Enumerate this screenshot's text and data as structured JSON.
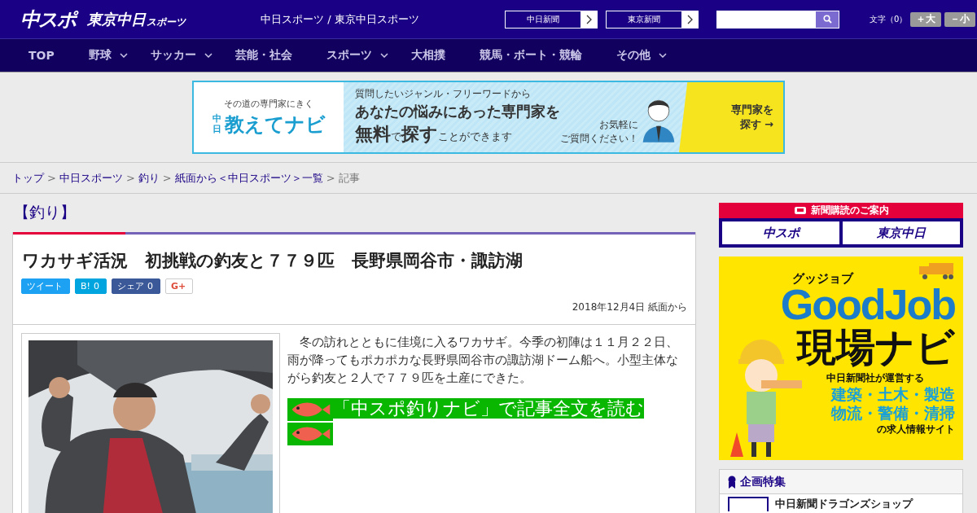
{
  "header": {
    "logo": "中スポ",
    "logo2": "東京中日",
    "logo2_small": "スポーツ",
    "site_title": "中日スポーツ / 東京中日スポーツ",
    "paper_links": [
      {
        "label": "中日新聞"
      },
      {
        "label": "東京新聞"
      }
    ],
    "font_size": {
      "label": "文字（0）",
      "buttons": [
        "＋大",
        "－小"
      ]
    }
  },
  "nav": [
    {
      "label": "TOP",
      "dropdown": false
    },
    {
      "label": "野球",
      "dropdown": true
    },
    {
      "label": "サッカー",
      "dropdown": true
    },
    {
      "label": "芸能・社会",
      "dropdown": false
    },
    {
      "label": "スポーツ",
      "dropdown": true
    },
    {
      "label": "大相撲",
      "dropdown": false
    },
    {
      "label": "競馬・ボート・競輪",
      "dropdown": false
    },
    {
      "label": "その他",
      "dropdown": true
    }
  ],
  "ad_banner": {
    "tagline": "その道の専門家にきく",
    "brand_small": "中日",
    "brand": "教えてナビ",
    "lead": "質問したいジャンル・フリーワードから",
    "headline": "あなたの悩みにあった専門家を",
    "headline2": "**無料**で**探す**ことができます",
    "note": [
      "お気軽に",
      "ご質問ください！"
    ],
    "cta": [
      "専門家を",
      "探す →"
    ]
  },
  "breadcrumb": [
    {
      "label": "トップ",
      "link": true
    },
    {
      "label": "中日スポーツ",
      "link": true
    },
    {
      "label": "釣り",
      "link": true
    },
    {
      "label": "紙面から＜中日スポーツ＞一覧",
      "link": true
    },
    {
      "label": "記事",
      "link": false
    }
  ],
  "breadcrumb_separator": ">",
  "category": "【釣り】",
  "article": {
    "title": "ワカサギ活況　初挑戦の釣友と７７９匹　長野県岡谷市・諏訪湖",
    "share": [
      {
        "kind": "twitter",
        "label": "ツイート"
      },
      {
        "kind": "hatena",
        "label": "B!",
        "count": "0"
      },
      {
        "kind": "facebook",
        "label": "シェア",
        "count": "0"
      },
      {
        "kind": "gplus",
        "label": "G+"
      }
    ],
    "date": "2018年12月4日 紙面から",
    "body": "　冬の訪れとともに佳境に入るワカサギ。今季の初陣は１１月２２日、雨が降ってもポカポカな長野県岡谷市の諏訪湖ドーム船へ。小型主体ながら釣友と２人で７７９匹を土産にできた。",
    "read_more": "「中スポ釣りナビ」で記事全文を読む"
  },
  "sidebar": {
    "subscribe": {
      "title": "新聞購読のご案内",
      "logos": [
        "中スポ",
        "東京中日"
      ]
    },
    "job_ad": {
      "kana": "グッジョブ",
      "brand": "GoodJob",
      "title": "現場ナビ",
      "lead": "中日新聞社が運営する",
      "fields": [
        "建築・土木・製造",
        "物流・警備・清掃"
      ],
      "tail": "の求人情報サイト"
    },
    "feature": {
      "title": "企画特集",
      "items": [
        {
          "label": "中日新聞ドラゴンズショップ"
        }
      ]
    }
  }
}
